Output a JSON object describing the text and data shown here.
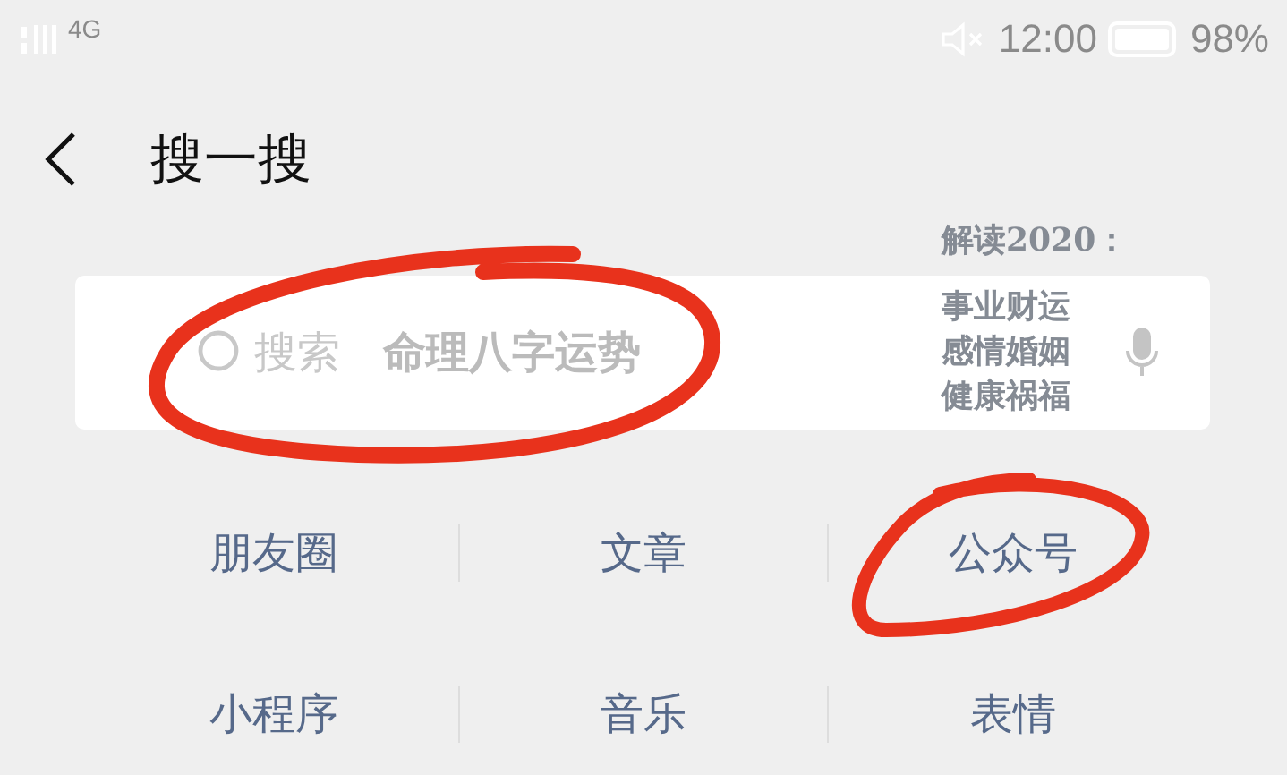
{
  "status_bar": {
    "network": "4G",
    "time": "12:00",
    "battery": "98%"
  },
  "header": {
    "title": "搜一搜"
  },
  "search": {
    "placeholder": "搜索",
    "hint": "命理八字运势"
  },
  "overlay_text": [
    "解读2020：",
    "事业财运",
    "感情婚姻",
    "健康祸福"
  ],
  "categories": [
    [
      "朋友圈",
      "文章",
      "公众号"
    ],
    [
      "小程序",
      "音乐",
      "表情"
    ]
  ]
}
